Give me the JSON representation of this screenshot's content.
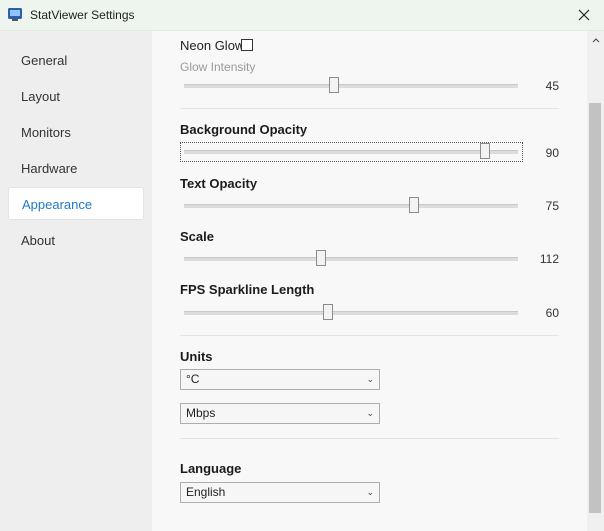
{
  "window": {
    "title": "StatViewer Settings"
  },
  "sidebar": {
    "items": [
      {
        "label": "General"
      },
      {
        "label": "Layout"
      },
      {
        "label": "Monitors"
      },
      {
        "label": "Hardware"
      },
      {
        "label": "Appearance",
        "active": true
      },
      {
        "label": "About"
      }
    ]
  },
  "appearance": {
    "neon_glow": {
      "label": "Neon Glow",
      "checked": false
    },
    "glow_intensity": {
      "label": "Glow Intensity",
      "value": "45",
      "fraction": 0.45,
      "enabled": false
    },
    "background_opacity": {
      "label": "Background Opacity",
      "value": "90",
      "fraction": 0.9
    },
    "text_opacity": {
      "label": "Text Opacity",
      "value": "75",
      "fraction": 0.69
    },
    "scale": {
      "label": "Scale",
      "value": "112",
      "fraction": 0.41
    },
    "fps_sparkline": {
      "label": "FPS Sparkline Length",
      "value": "60",
      "fraction": 0.43
    },
    "units": {
      "label": "Units",
      "temperature": "°C",
      "network": "Mbps"
    },
    "language": {
      "label": "Language",
      "value": "English"
    }
  },
  "colors": {
    "accent": "#1f7ac9",
    "titlebar": "#eef5ee"
  }
}
